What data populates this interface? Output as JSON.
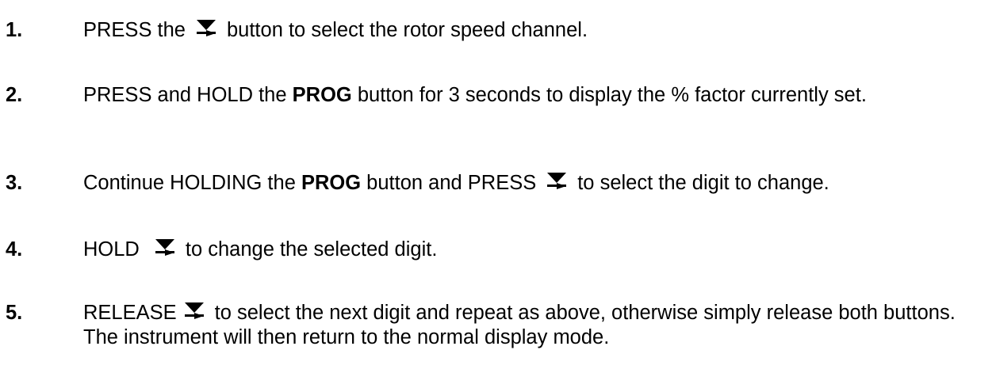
{
  "steps": [
    {
      "number": "1.",
      "part1": "PRESS the",
      "icon": "arrow-down-select-icon",
      "part2": "button to select the rotor speed channel."
    },
    {
      "number": "2.",
      "part1": "PRESS and HOLD the",
      "bold": "PROG",
      "part2": "button for 3 seconds to display the % factor currently set."
    },
    {
      "number": "3.",
      "part1": "Continue HOLDING the",
      "bold": "PROG",
      "part2": "button and PRESS",
      "icon": "arrow-down-select-icon",
      "part3": "to select the digit to change."
    },
    {
      "number": "4.",
      "part1": "HOLD",
      "icon": "arrow-down-select-icon",
      "part2": "to change the selected digit."
    },
    {
      "number": "5.",
      "part1": "RELEASE",
      "icon": "arrow-down-select-icon",
      "part2": "to select the next digit and repeat as above, otherwise simply release both buttons. The instrument will then return to the normal display mode."
    }
  ]
}
